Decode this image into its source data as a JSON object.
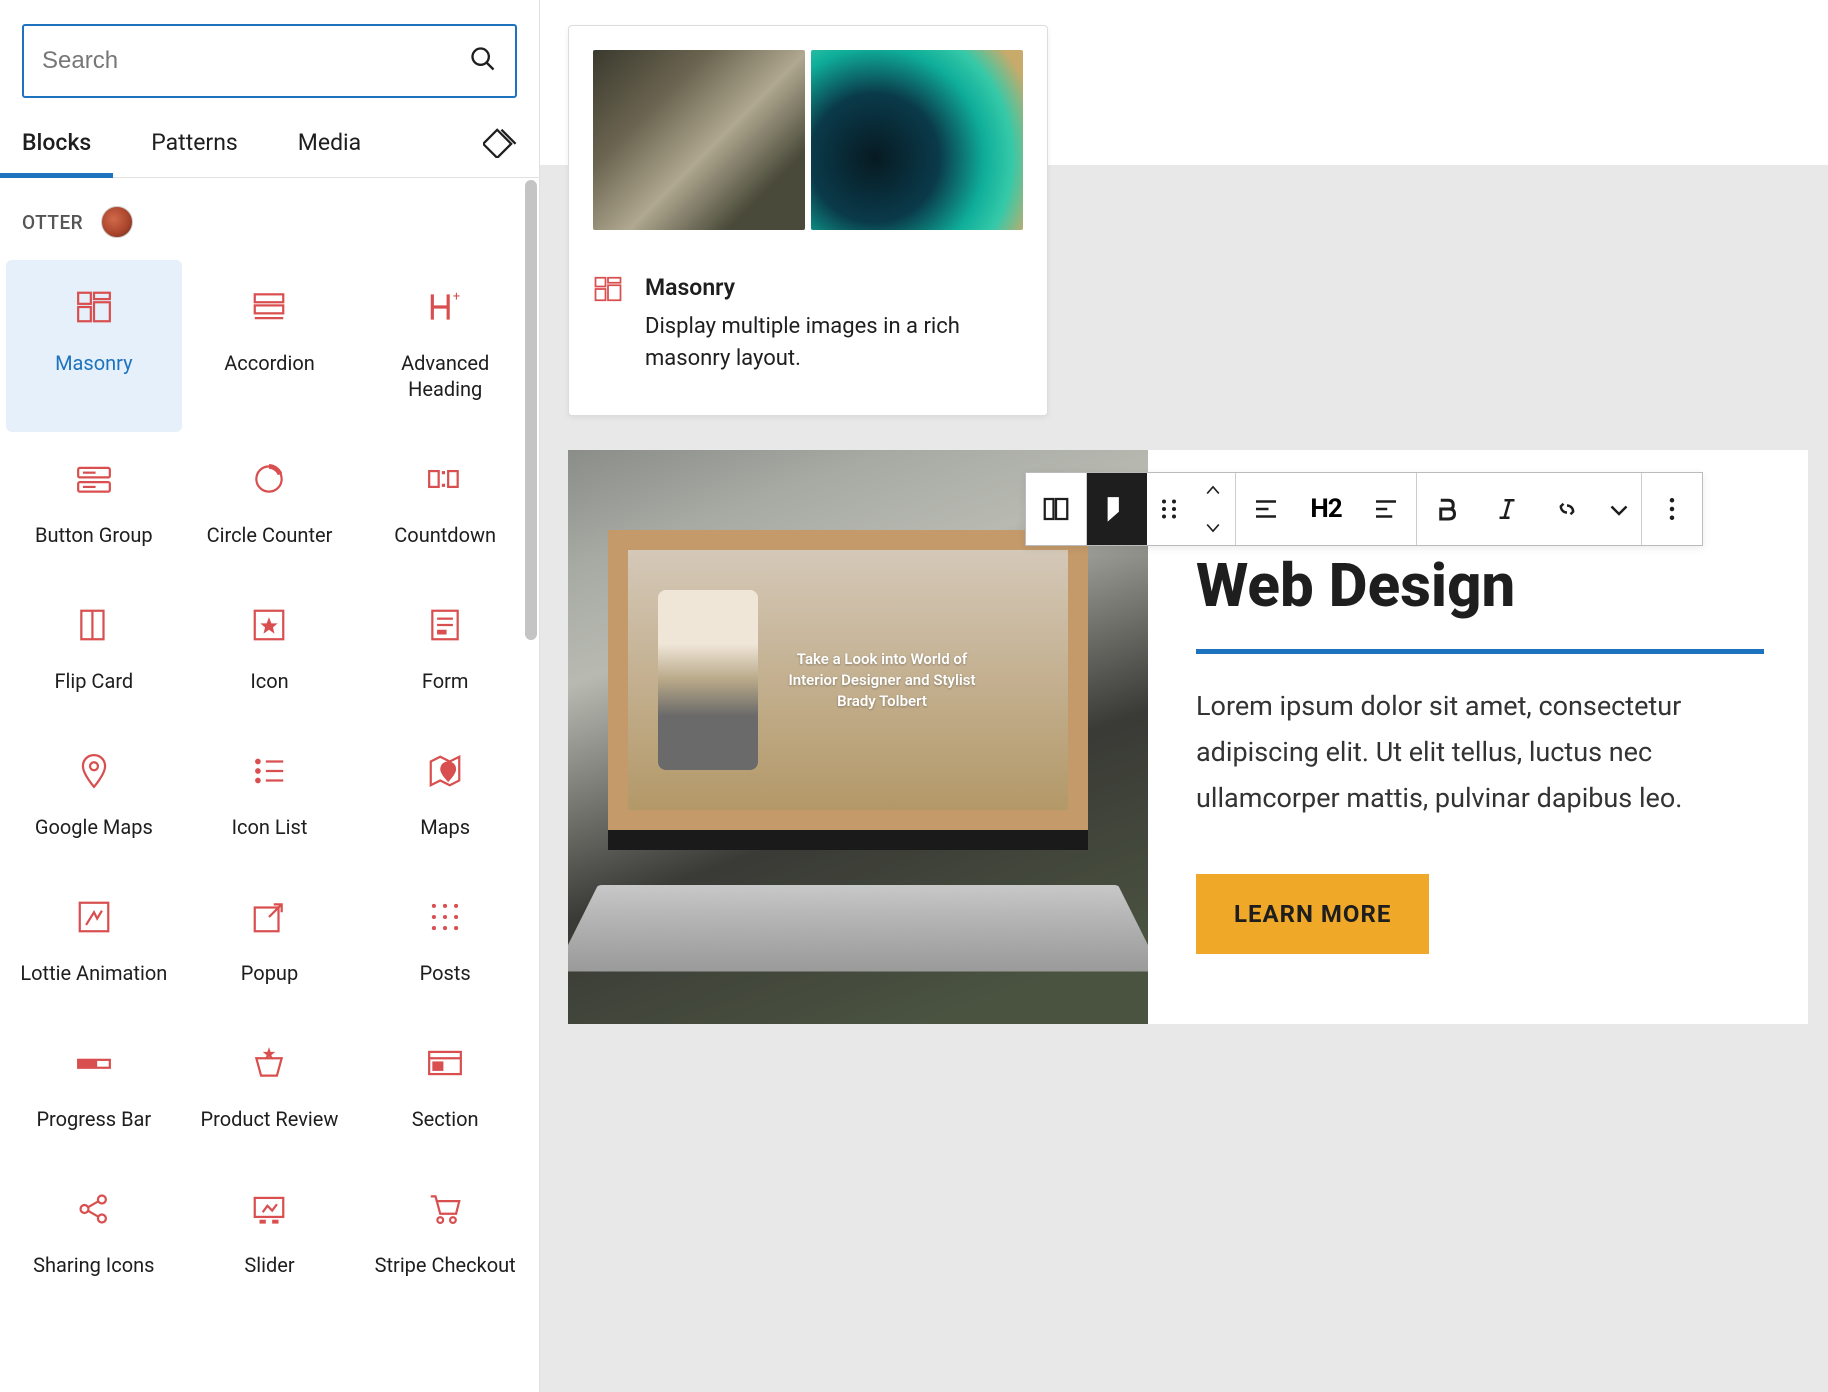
{
  "search": {
    "placeholder": "Search"
  },
  "tabs": {
    "blocks": "Blocks",
    "patterns": "Patterns",
    "media": "Media"
  },
  "section": {
    "title": "OTTER"
  },
  "blocks": [
    {
      "label": "Masonry",
      "icon": "masonry",
      "selected": true
    },
    {
      "label": "Accordion",
      "icon": "accordion"
    },
    {
      "label": "Advanced Heading",
      "icon": "advanced-heading"
    },
    {
      "label": "Button Group",
      "icon": "button-group"
    },
    {
      "label": "Circle Counter",
      "icon": "circle-counter"
    },
    {
      "label": "Countdown",
      "icon": "countdown"
    },
    {
      "label": "Flip Card",
      "icon": "flip-card"
    },
    {
      "label": "Icon",
      "icon": "icon-block"
    },
    {
      "label": "Form",
      "icon": "form"
    },
    {
      "label": "Google Maps",
      "icon": "google-maps"
    },
    {
      "label": "Icon List",
      "icon": "icon-list"
    },
    {
      "label": "Maps",
      "icon": "maps"
    },
    {
      "label": "Lottie Animation",
      "icon": "lottie"
    },
    {
      "label": "Popup",
      "icon": "popup"
    },
    {
      "label": "Posts",
      "icon": "posts"
    },
    {
      "label": "Progress Bar",
      "icon": "progress-bar"
    },
    {
      "label": "Product Review",
      "icon": "product-review"
    },
    {
      "label": "Section",
      "icon": "section"
    },
    {
      "label": "Sharing Icons",
      "icon": "sharing"
    },
    {
      "label": "Slider",
      "icon": "slider"
    },
    {
      "label": "Stripe Checkout",
      "icon": "stripe"
    }
  ],
  "preview": {
    "title": "Masonry",
    "description": "Display multiple images in a rich masonry layout."
  },
  "content": {
    "heading": "Web Design",
    "paragraph": "Lorem ipsum dolor sit amet, consectetur adipiscing elit. Ut elit tellus, luctus nec ullamcorper mattis, pulvinar dapibus leo.",
    "button": "LEARN MORE",
    "screen_text": "Take a Look into World of Interior Designer and Stylist Brady Tolbert"
  },
  "toolbar": {
    "heading_level": "H2"
  },
  "colors": {
    "accent": "#1e73be",
    "brand": "#d94f4f",
    "button": "#f0a829"
  }
}
